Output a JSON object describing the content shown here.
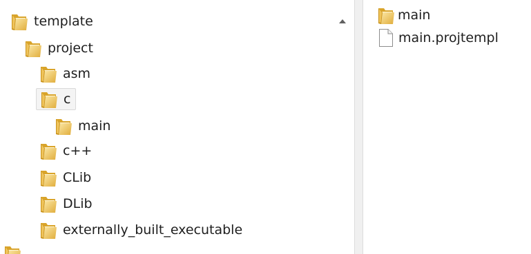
{
  "tree": {
    "items": [
      {
        "label": "template",
        "icon": "folder-icon",
        "selected": false
      },
      {
        "label": "project",
        "icon": "folder-icon",
        "selected": false
      },
      {
        "label": "asm",
        "icon": "folder-icon",
        "selected": false
      },
      {
        "label": "c",
        "icon": "folder-icon",
        "selected": true
      },
      {
        "label": "main",
        "icon": "folder-icon",
        "selected": false
      },
      {
        "label": "c++",
        "icon": "folder-icon",
        "selected": false
      },
      {
        "label": "CLib",
        "icon": "folder-icon",
        "selected": false
      },
      {
        "label": "DLib",
        "icon": "folder-icon",
        "selected": false
      },
      {
        "label": "externally_built_executable",
        "icon": "folder-icon",
        "selected": false
      },
      {
        "label": "",
        "icon": "folder-icon",
        "selected": false
      }
    ]
  },
  "scrollbar": {
    "up_arrow_icon": "scroll-up-arrow-icon"
  },
  "content": {
    "items": [
      {
        "label": "main",
        "icon": "folder-icon"
      },
      {
        "label": "main.projtempl",
        "icon": "file-icon"
      }
    ]
  },
  "colors": {
    "folder_light": "#f8d980",
    "folder_dark": "#d9a42a",
    "selection_bg": "#f4f4f4",
    "selection_border": "#d9d9d9",
    "splitter": "#f0f0f0"
  }
}
